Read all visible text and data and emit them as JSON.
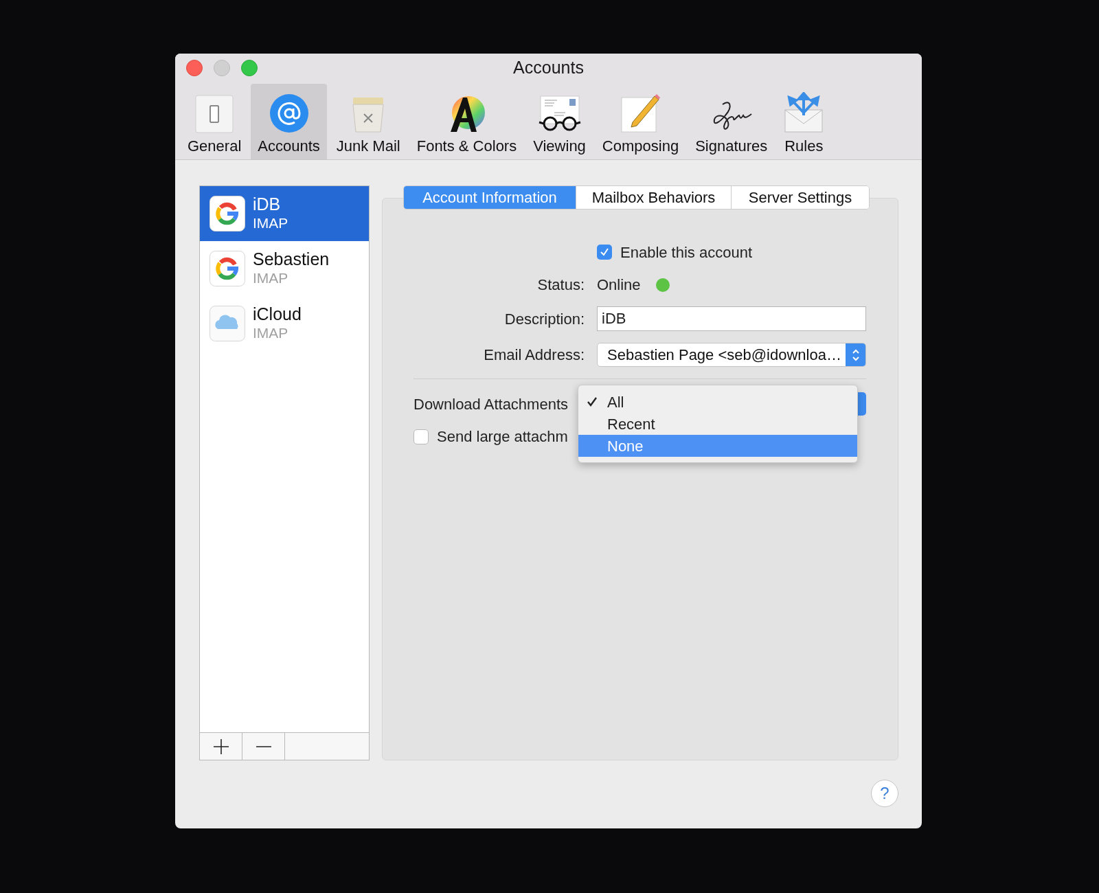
{
  "window": {
    "title": "Accounts"
  },
  "toolbar": [
    {
      "label": "General",
      "kind": "general",
      "selected": false
    },
    {
      "label": "Accounts",
      "kind": "accounts",
      "selected": true
    },
    {
      "label": "Junk Mail",
      "kind": "junk",
      "selected": false
    },
    {
      "label": "Fonts & Colors",
      "kind": "fonts",
      "selected": false
    },
    {
      "label": "Viewing",
      "kind": "viewing",
      "selected": false
    },
    {
      "label": "Composing",
      "kind": "composing",
      "selected": false
    },
    {
      "label": "Signatures",
      "kind": "signatures",
      "selected": false
    },
    {
      "label": "Rules",
      "kind": "rules",
      "selected": false
    }
  ],
  "accounts": [
    {
      "name": "iDB",
      "type": "IMAP",
      "kind": "google",
      "selected": true
    },
    {
      "name": "Sebastien",
      "type": "IMAP",
      "kind": "google",
      "selected": false
    },
    {
      "name": "iCloud",
      "type": "IMAP",
      "kind": "icloud",
      "selected": false
    }
  ],
  "tabs": [
    {
      "label": "Account Information",
      "selected": true
    },
    {
      "label": "Mailbox Behaviors",
      "selected": false
    },
    {
      "label": "Server Settings",
      "selected": false
    }
  ],
  "form": {
    "enable": {
      "label": "Enable this account",
      "checked": true
    },
    "status": {
      "label": "Status:",
      "value": "Online"
    },
    "description": {
      "label": "Description:",
      "value": "iDB"
    },
    "email": {
      "label": "Email Address:",
      "value": "Sebastien Page <seb@idownloa…"
    },
    "download": {
      "label": "Download Attachments"
    },
    "send_large": {
      "label": "Send large attachm",
      "checked": false
    }
  },
  "menu": [
    {
      "label": "All",
      "checked": true,
      "selected": false
    },
    {
      "label": "Recent",
      "checked": false,
      "selected": false
    },
    {
      "label": "None",
      "checked": false,
      "selected": true
    }
  ],
  "help": "?"
}
